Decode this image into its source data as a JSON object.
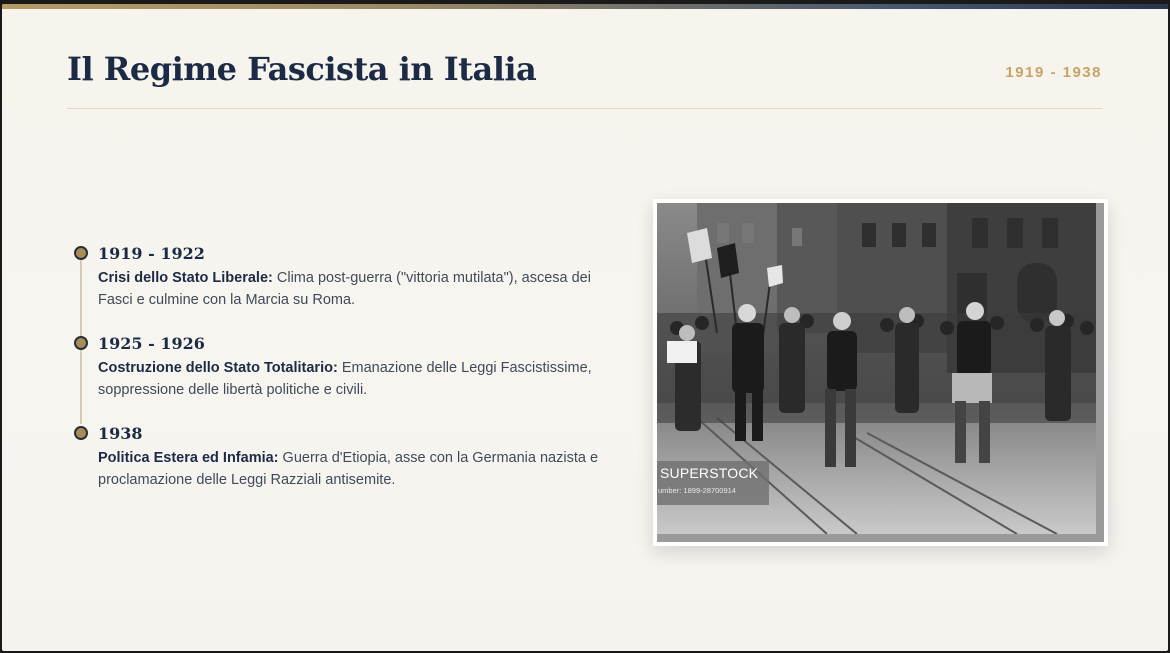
{
  "slide": {
    "title": "Il Regime Fascista in Italia",
    "date_range": "1919 - 1938"
  },
  "timeline": [
    {
      "year": "1919 - 1922",
      "heading": "Crisi dello Stato Liberale:",
      "text": " Clima post-guerra (\"vittoria mutilata\"), ascesa dei Fasci e culmine con la Marcia su Roma."
    },
    {
      "year": "1925 - 1926",
      "heading": "Costruzione dello Stato Totalitario:",
      "text": " Emanazione delle Leggi Fascistissime, soppressione delle libertà politiche e civili."
    },
    {
      "year": "1938",
      "heading": "Politica Estera ed Infamia:",
      "text": " Guerra d'Etiopia, asse con la Germania nazista e proclamazione delle Leggi Razziali antisemite."
    }
  ],
  "photo": {
    "watermark_brand": "SUPERSTOCK",
    "watermark_number": "umber: 1899-28700914"
  },
  "colors": {
    "title": "#1c2b45",
    "accent_gold": "#c5a466",
    "body_text": "#404a58",
    "background": "#f7f5f0"
  }
}
